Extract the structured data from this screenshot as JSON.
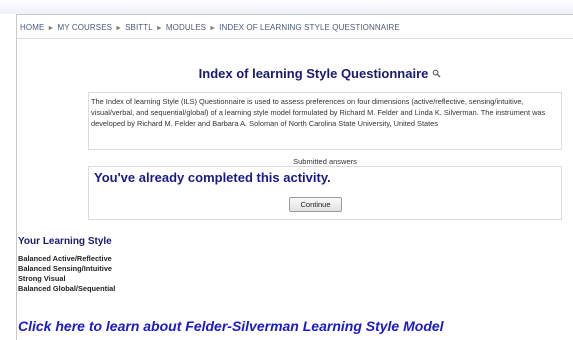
{
  "breadcrumb": {
    "items": [
      "HOME",
      "MY COURSES",
      "SBITTL",
      "MODULES",
      "INDEX OF LEARNING STYLE QUESTIONNAIRE"
    ],
    "separator": "►"
  },
  "page": {
    "title": "Index of learning Style Questionnaire",
    "title_icon": "magnifier-icon",
    "intro": "The Index of learning Style (ILS) Questionnaire is used to assess preferences on four dimensions (active/reflective, sensing/intuitive, visual/verbal, and sequential/global) of a learning style model formulated by Richard M. Felder and Linda K. Silverman. The instrument was developed by Richard M. Felder and Barbara A. Soloman of North Carolina State University, United States"
  },
  "submission": {
    "label": "Submitted answers",
    "message": "You've already completed this activity.",
    "continue_label": "Continue"
  },
  "learning_style": {
    "heading": "Your Learning Style",
    "results": [
      "Balanced Active/Reflective",
      "Balanced Sensing/Intuitive",
      "Strong Visual",
      "Balanced Global/Sequential"
    ]
  },
  "model_link": {
    "text": "Click here to learn about Felder-Silverman Learning Style Model"
  },
  "colors": {
    "heading": "#1a1a6e",
    "message": "#1a1a8a",
    "link": "#1a1acc",
    "border": "#dcdcdc"
  }
}
